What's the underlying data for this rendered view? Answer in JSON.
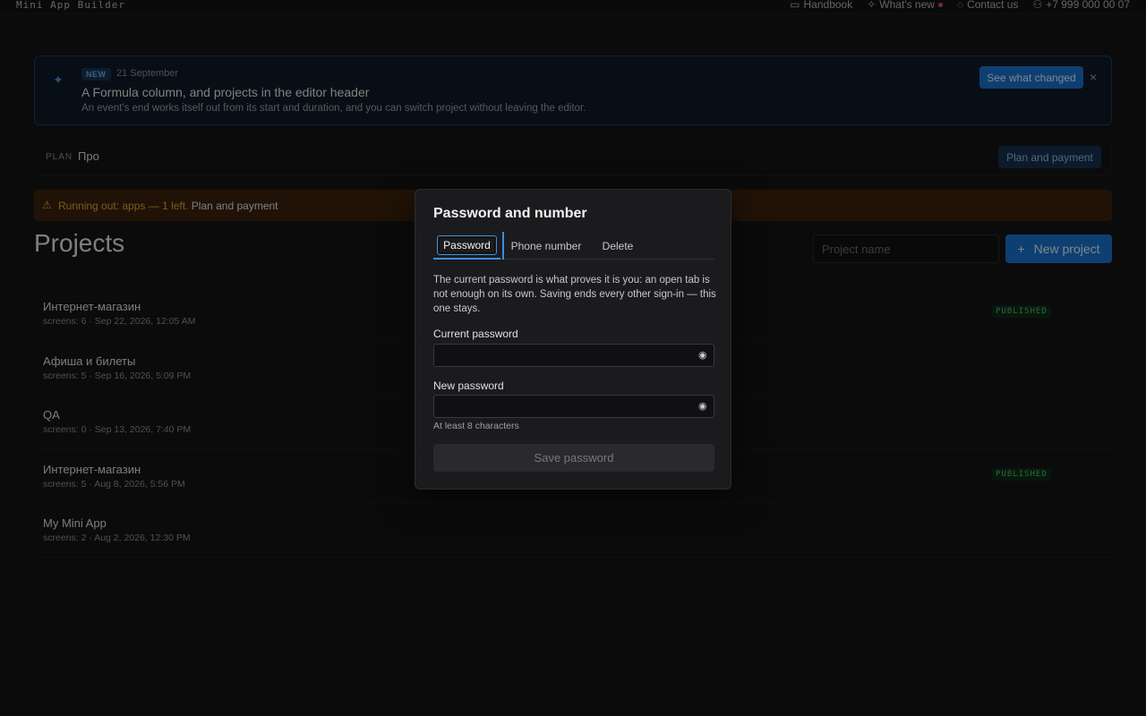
{
  "topbar": {
    "app_name": "Mini App Builder",
    "handbook": "Handbook",
    "whats_new": "What's new",
    "contact": "Contact us",
    "phone": "+7 999 000 00 07"
  },
  "banner": {
    "badge": "NEW",
    "date": "21 September",
    "title": "A Formula column, and projects in the editor header",
    "description": "An event's end works itself out from its start and duration, and you can switch project without leaving the editor.",
    "see_button": "See what changed",
    "close_glyph": "×"
  },
  "plan": {
    "label": "PLAN",
    "value": "Про",
    "button": "Plan and payment"
  },
  "warning": {
    "icon": "⚠",
    "text": "Running out: apps — 1 left.",
    "link": "Plan and payment"
  },
  "projects": {
    "title": "Projects",
    "search_placeholder": "Project name",
    "new_button": "New project",
    "new_icon": "+",
    "items": [
      {
        "name": "Интернет-магазин",
        "meta": "screens: 6 · Sep 22, 2026, 12:05 AM",
        "status": "PUBLISHED"
      },
      {
        "name": "Афиша и билеты",
        "meta": "screens: 5 · Sep 16, 2026, 5:09 PM",
        "status": ""
      },
      {
        "name": "QA",
        "meta": "screens: 0 · Sep 13, 2026, 7:40 PM",
        "status": ""
      },
      {
        "name": "Интернет-магазин",
        "meta": "screens: 5 · Aug 8, 2026, 5:56 PM",
        "status": "PUBLISHED"
      },
      {
        "name": "My Mini App",
        "meta": "screens: 2 · Aug 2, 2026, 12:30 PM",
        "status": ""
      }
    ]
  },
  "modal": {
    "title": "Password and number",
    "tabs": [
      "Password",
      "Phone number",
      "Delete"
    ],
    "description": "The current password is what proves it is you: an open tab is not enough on its own. Saving ends every other sign-in — this one stays.",
    "current_label": "Current password",
    "current_value": "",
    "new_label": "New password",
    "new_value": "",
    "hint": "At least 8 characters",
    "save_button": "Save password"
  },
  "colors": {
    "accent": "#1a73d1",
    "warning": "#e8a23a",
    "published": "#4fbf6a"
  }
}
